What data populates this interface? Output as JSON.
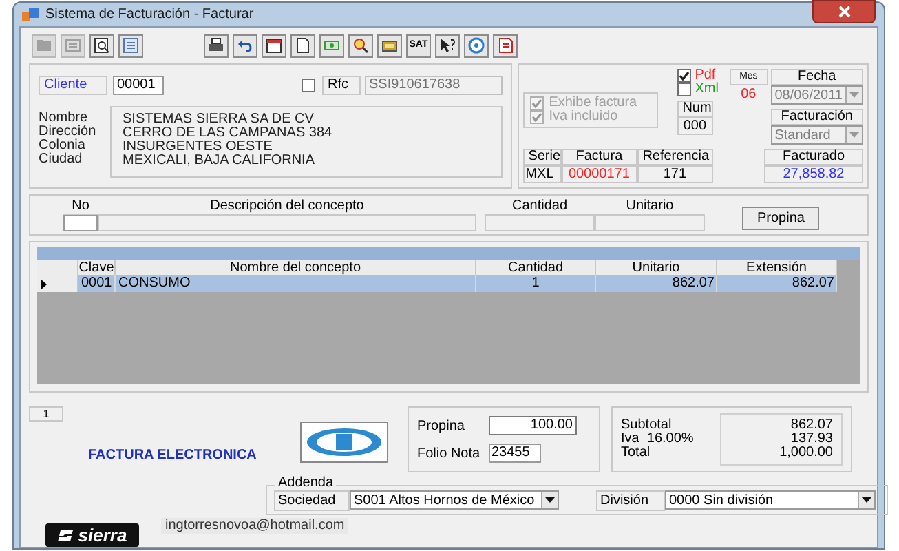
{
  "window": {
    "title": "Sistema de Facturación - Facturar"
  },
  "toolbar": {
    "left": [
      {
        "kind": "folder",
        "disabled": true
      },
      {
        "kind": "card",
        "disabled": true
      },
      {
        "kind": "preview",
        "disabled": false
      },
      {
        "kind": "list",
        "disabled": false
      }
    ],
    "right": [
      {
        "kind": "printer"
      },
      {
        "kind": "undo"
      },
      {
        "kind": "calendar"
      },
      {
        "kind": "page"
      },
      {
        "kind": "money"
      },
      {
        "kind": "find"
      },
      {
        "kind": "box"
      },
      {
        "kind": "text",
        "label": "SAT"
      },
      {
        "kind": "help"
      },
      {
        "kind": "disc"
      },
      {
        "kind": "pdf"
      }
    ]
  },
  "cliente": {
    "label": "Cliente",
    "value": "00001"
  },
  "rfc": {
    "checked": false,
    "label": "Rfc",
    "value": "SSI910617638"
  },
  "address": [
    {
      "label": "Nombre",
      "value": "SISTEMAS SIERRA SA DE CV"
    },
    {
      "label": "Dirección",
      "value": "CERRO DE LAS CAMPANAS 384"
    },
    {
      "label": "Colonia",
      "value": "INSURGENTES OESTE"
    },
    {
      "label": "Ciudad",
      "value": "MEXICALI, BAJA CALIFORNIA"
    }
  ],
  "options": [
    {
      "label": "Exhibe factura",
      "checked": true
    },
    {
      "label": "Iva incluido",
      "checked": true
    }
  ],
  "formats": [
    {
      "label": "Pdf",
      "checked": true,
      "color": "#ff2020"
    },
    {
      "label": "Xml",
      "checked": false,
      "color": "#20a020"
    }
  ],
  "mes": {
    "label": "Mes",
    "value": "06"
  },
  "fecha": {
    "label": "Fecha",
    "value": "08/06/2011"
  },
  "num": {
    "label": "Num",
    "value": "000"
  },
  "facturacion": {
    "label": "Facturación",
    "value": "Standard"
  },
  "invoice_fields": [
    {
      "label": "Serie",
      "value": "MXL",
      "color": "#000000"
    },
    {
      "label": "Factura",
      "value": "00000171",
      "color": "#ff2020"
    },
    {
      "label": "Referencia",
      "value": "171",
      "color": "#000000"
    }
  ],
  "facturado": {
    "label": "Facturado",
    "value": "27,858.82"
  },
  "concept_entry": {
    "columns": [
      "No",
      "Descripción del concepto",
      "Cantidad",
      "Unitario"
    ],
    "button": "Propina"
  },
  "grid": {
    "columns": [
      "Clave",
      "Nombre del concepto",
      "Cantidad",
      "Unitario",
      "Extensión"
    ],
    "rows": [
      {
        "selected": true,
        "cells": [
          "0001",
          "CONSUMO",
          "1",
          "862.07",
          "862.07"
        ]
      }
    ]
  },
  "record_count": "1",
  "banner": "FACTURA ELECTRONICA",
  "propina": {
    "label": "Propina",
    "value": "100.00"
  },
  "folio_nota": {
    "label": "Folio Nota",
    "value": "23455"
  },
  "totals": [
    {
      "label": "Subtotal",
      "value": "862.07"
    },
    {
      "label": "Iva  16.00%",
      "value": "137.93"
    },
    {
      "label": "Total",
      "value": "1,000.00"
    }
  ],
  "addenda": {
    "legend": "Addenda",
    "sociedad": {
      "label": "Sociedad",
      "value": "S001 Altos Hornos de México"
    },
    "division": {
      "label": "División",
      "value": "0000  Sin división"
    }
  },
  "logo": "sierra",
  "email": "ingtorresnovoa@hotmail.com"
}
